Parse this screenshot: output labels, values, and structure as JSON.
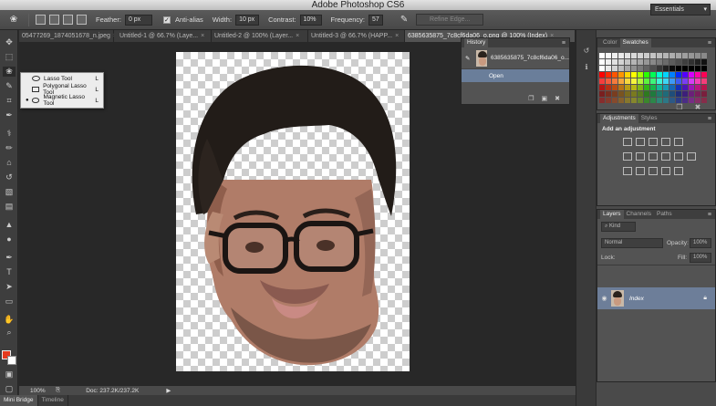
{
  "app": {
    "title": "Adobe Photoshop CS6"
  },
  "options": {
    "feather_label": "Feather:",
    "feather_value": "0 px",
    "antialias_label": "Anti-alias",
    "antialias_checked": true,
    "width_label": "Width:",
    "width_value": "10 px",
    "contrast_label": "Contrast:",
    "contrast_value": "10%",
    "frequency_label": "Frequency:",
    "frequency_value": "57",
    "refine_edge_label": "Refine Edge...",
    "workspace": "Essentials"
  },
  "tabs": [
    {
      "label": "05477269_1874051678_n.jpeg",
      "active": false
    },
    {
      "label": "Untitled-1 @ 66.7% (Laye...",
      "active": false
    },
    {
      "label": "Untitled-2 @ 100% (Layer...",
      "active": false
    },
    {
      "label": "Untitled-3 @ 66.7% (HAPP...",
      "active": false
    },
    {
      "label": "6385635875_7c8cf6da06_o.png @ 100% (Index)",
      "active": true
    }
  ],
  "lasso_menu": {
    "items": [
      {
        "label": "Lasso Tool",
        "shortcut": "L",
        "selected": false
      },
      {
        "label": "Polygonal Lasso Tool",
        "shortcut": "L",
        "selected": false
      },
      {
        "label": "Magnetic Lasso Tool",
        "shortcut": "L",
        "selected": true
      }
    ]
  },
  "history": {
    "tabs": [
      "History"
    ],
    "snapshot_label": "6385635875_7c8cf6da06_o...",
    "states": [
      "Open"
    ]
  },
  "status": {
    "zoom": "100%",
    "doc": "Doc: 237.2K/237.2K"
  },
  "bottom_tabs": [
    "Mini Bridge",
    "Timeline"
  ],
  "color_panel": {
    "tabs": [
      "Color",
      "Swatches"
    ]
  },
  "adjustments_panel": {
    "tabs": [
      "Adjustments",
      "Styles"
    ],
    "heading": "Add an adjustment"
  },
  "layers_panel": {
    "tabs": [
      "Layers",
      "Channels",
      "Paths"
    ],
    "kind_filter": "Kind",
    "blend_mode": "Normal",
    "opacity_label": "Opacity:",
    "opacity_value": "100%",
    "lock_label": "Lock:",
    "fill_label": "Fill:",
    "fill_value": "100%",
    "layers": [
      {
        "name": "Index",
        "visible": true,
        "locked": true
      }
    ]
  },
  "colors": {
    "foreground": "#e53a1e",
    "background": "#ffffff",
    "selection_highlight": "#6d7e99"
  },
  "icons": {
    "toolbar": [
      "move-icon",
      "marquee-icon",
      "lasso-icon",
      "quick-select-icon",
      "crop-icon",
      "eyedropper-icon",
      "healing-icon",
      "brush-icon",
      "clone-stamp-icon",
      "history-brush-icon",
      "eraser-icon",
      "gradient-icon",
      "blur-icon",
      "dodge-icon",
      "pen-icon",
      "type-icon",
      "path-select-icon",
      "shape-icon",
      "hand-icon",
      "zoom-icon"
    ]
  }
}
